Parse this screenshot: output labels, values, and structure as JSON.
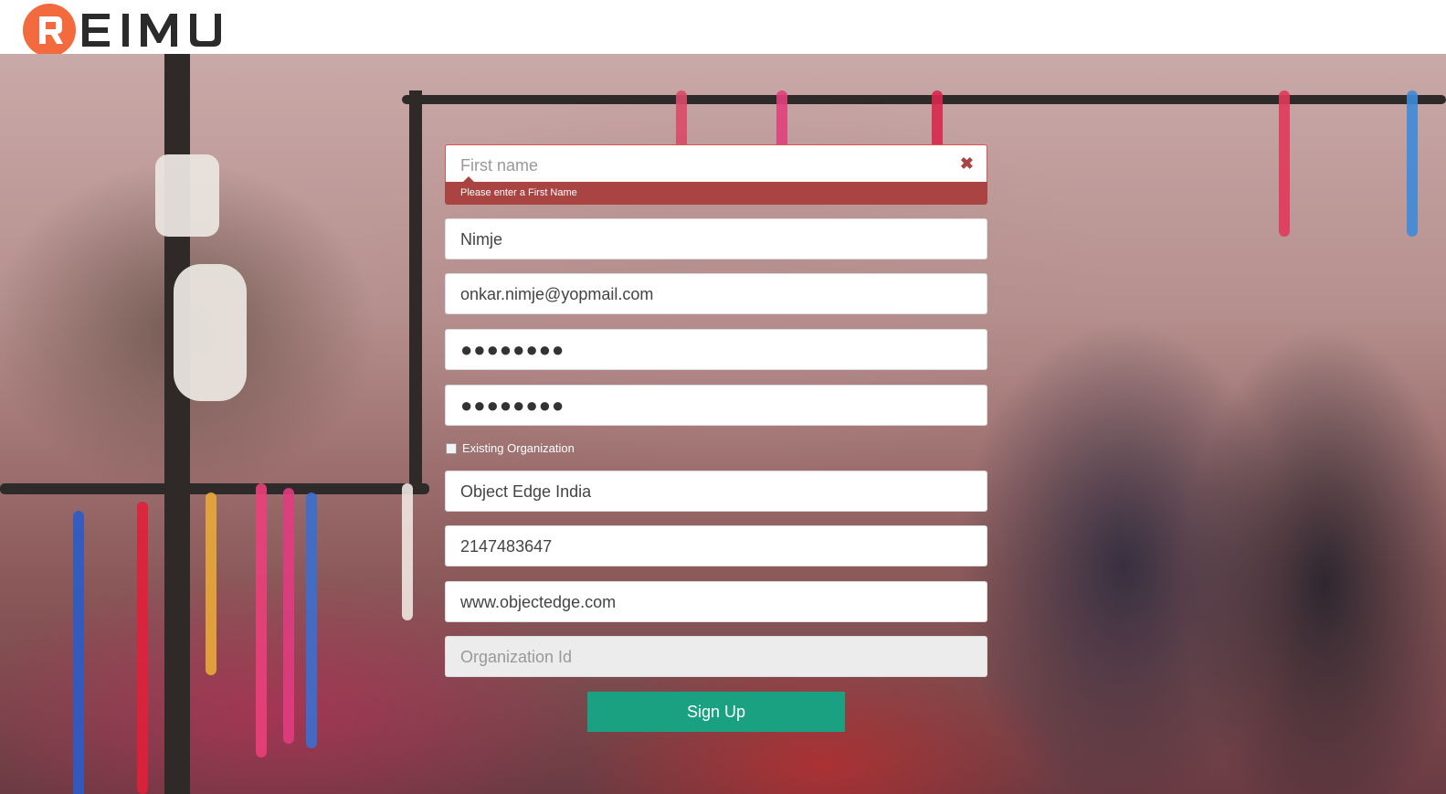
{
  "brand": {
    "logo_text": "REIMU",
    "logo_color": "#f26a3d"
  },
  "form": {
    "first_name": {
      "placeholder": "First name",
      "value": "",
      "error": "Please enter a First Name",
      "clear_icon": "close-icon"
    },
    "last_name": {
      "value": "Nimje"
    },
    "email": {
      "value": "onkar.nimje@yopmail.com"
    },
    "password": {
      "value": "●●●●●●●●"
    },
    "confirm_password": {
      "value": "●●●●●●●●"
    },
    "existing_org": {
      "label": "Existing Organization",
      "checked": false
    },
    "organization_name": {
      "value": "Object Edge India"
    },
    "phone": {
      "value": "2147483647"
    },
    "website": {
      "value": "www.objectedge.com"
    },
    "organization_id": {
      "placeholder": "Organization Id",
      "value": ""
    },
    "submit_label": "Sign Up"
  },
  "colors": {
    "error": "#a94442",
    "primary_button": "#1aa182"
  }
}
